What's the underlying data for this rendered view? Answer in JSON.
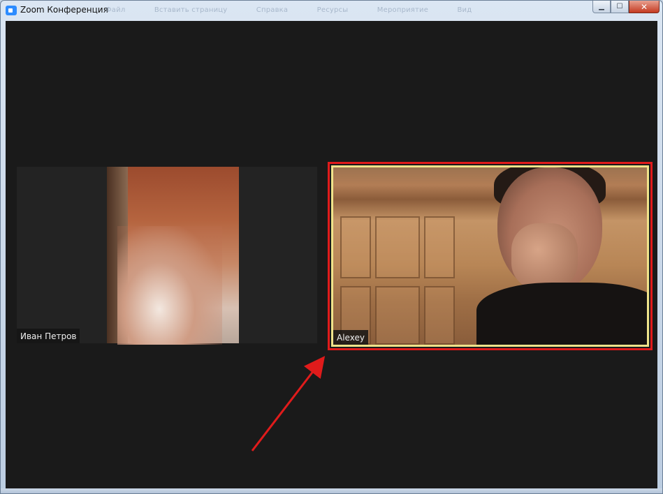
{
  "window": {
    "title": "Zoom Конференция",
    "ghost_menu": [
      "Файл",
      "Вставить страницу",
      "Справка",
      "Ресурсы",
      "Мероприятие",
      "Вид"
    ],
    "controls": {
      "minimize": "▁",
      "maximize": "☐",
      "close": "✕"
    }
  },
  "participants": [
    {
      "name": "Иван Петров",
      "video": "blurred"
    },
    {
      "name": "Alexey",
      "video": "camera",
      "active_speaker": true
    }
  ],
  "annotation": {
    "type": "arrow",
    "color": "#e01b1b",
    "points_to": "Alexey"
  },
  "colors": {
    "stage_bg": "#1a1a1a",
    "highlight_outer": "#e01b1b",
    "speaker_border": "#efe38a"
  }
}
